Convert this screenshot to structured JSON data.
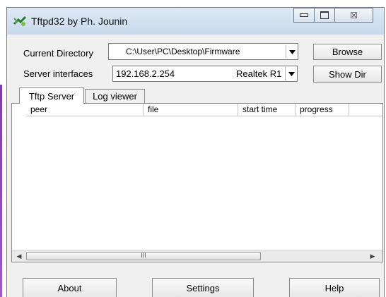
{
  "window": {
    "title": "Tftpd32 by Ph. Jounin"
  },
  "controls": {
    "minimize_icon": "minimize-icon",
    "maximize_icon": "maximize-icon",
    "close_icon": "close-icon",
    "close_glyph": "☒"
  },
  "current_directory": {
    "label": "Current Directory",
    "value": "C:\\User\\PC\\Desktop\\Firmware"
  },
  "server_interfaces": {
    "label": "Server interfaces",
    "ip": "192.168.2.254",
    "adapter": "Realtek R1"
  },
  "buttons": {
    "browse": "Browse",
    "show_dir": "Show Dir",
    "about": "About",
    "settings": "Settings",
    "help": "Help"
  },
  "tabs": [
    {
      "label": "Tftp Server",
      "active": true
    },
    {
      "label": "Log viewer",
      "active": false
    }
  ],
  "table": {
    "columns": [
      "peer",
      "file",
      "start time",
      "progress",
      ""
    ],
    "rows": []
  },
  "scrollbar": {
    "thumb_grip": "III"
  },
  "colors": {
    "title_gradient_top": "#dfe9f5",
    "title_gradient_bottom": "#c9d9ed",
    "window_bg": "#f0f0f0",
    "accent_purple": "#7b3fa8"
  }
}
